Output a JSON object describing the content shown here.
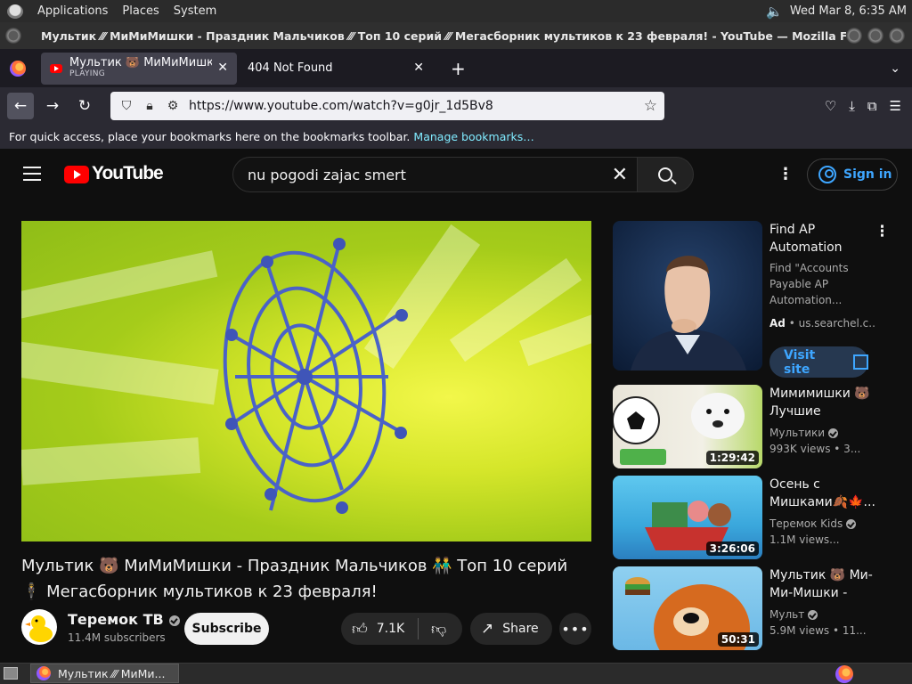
{
  "panel": {
    "applications": "Applications",
    "places": "Places",
    "system": "System",
    "clock": "Wed Mar  8,  6:35 AM"
  },
  "window": {
    "title": "Мультик ⁄⁄⁄ МиМиМишки - Праздник Мальчиков ⁄⁄⁄ Топ 10 серий ⁄⁄⁄ Мегасборник мультиков к 23 февраля! - YouTube — Mozilla Firefox"
  },
  "tabs": [
    {
      "label": "Мультик 🐻 МиМиМишки - ",
      "sub": "PLAYING"
    },
    {
      "label": "404 Not Found"
    }
  ],
  "nav": {
    "url": "https://www.youtube.com/watch?v=g0jr_1d5Bv8"
  },
  "bookmarks": {
    "text": "For quick access, place your bookmarks here on the bookmarks toolbar.",
    "link": "Manage bookmarks…"
  },
  "youtube": {
    "logo_text": "YouTube",
    "search_value": "nu pogodi zajac smert",
    "signin": "Sign in"
  },
  "video": {
    "title": "Мультик 🐻 МиМиМишки - Праздник Мальчиков 👬 Топ 10 серий 🕴 Мегасборник мультиков к 23 февраля!",
    "channel": "Теремок ТВ",
    "subscribers": "11.4M subscribers",
    "subscribe": "Subscribe",
    "likes": "7.1K",
    "share": "Share"
  },
  "sidebar": {
    "ad": {
      "title": "Find AP Automation",
      "desc": "Find \"Accounts Payable AP Automation...",
      "badge": "Ad",
      "domain": "us.searchel.c...",
      "visit": "Visit site"
    },
    "items": [
      {
        "title": "Мимимишки 🐻 Лучшие игроки...",
        "channel": "Мультики",
        "meta": "993K views • 3...",
        "duration": "1:29:42"
      },
      {
        "title": "Осень с Мишками🍂🍁...",
        "channel": "Теремок Kids",
        "meta": "1.1M views...",
        "duration": "3:26:06"
      },
      {
        "title": "Мультик 🐻 Ми-Ми-Мишки - ТО...",
        "channel": "Мульт",
        "meta": "5.9M views • 11...",
        "duration": "50:31"
      }
    ]
  },
  "taskbar": {
    "item": "Мультик ⁄⁄⁄ МиМи..."
  }
}
